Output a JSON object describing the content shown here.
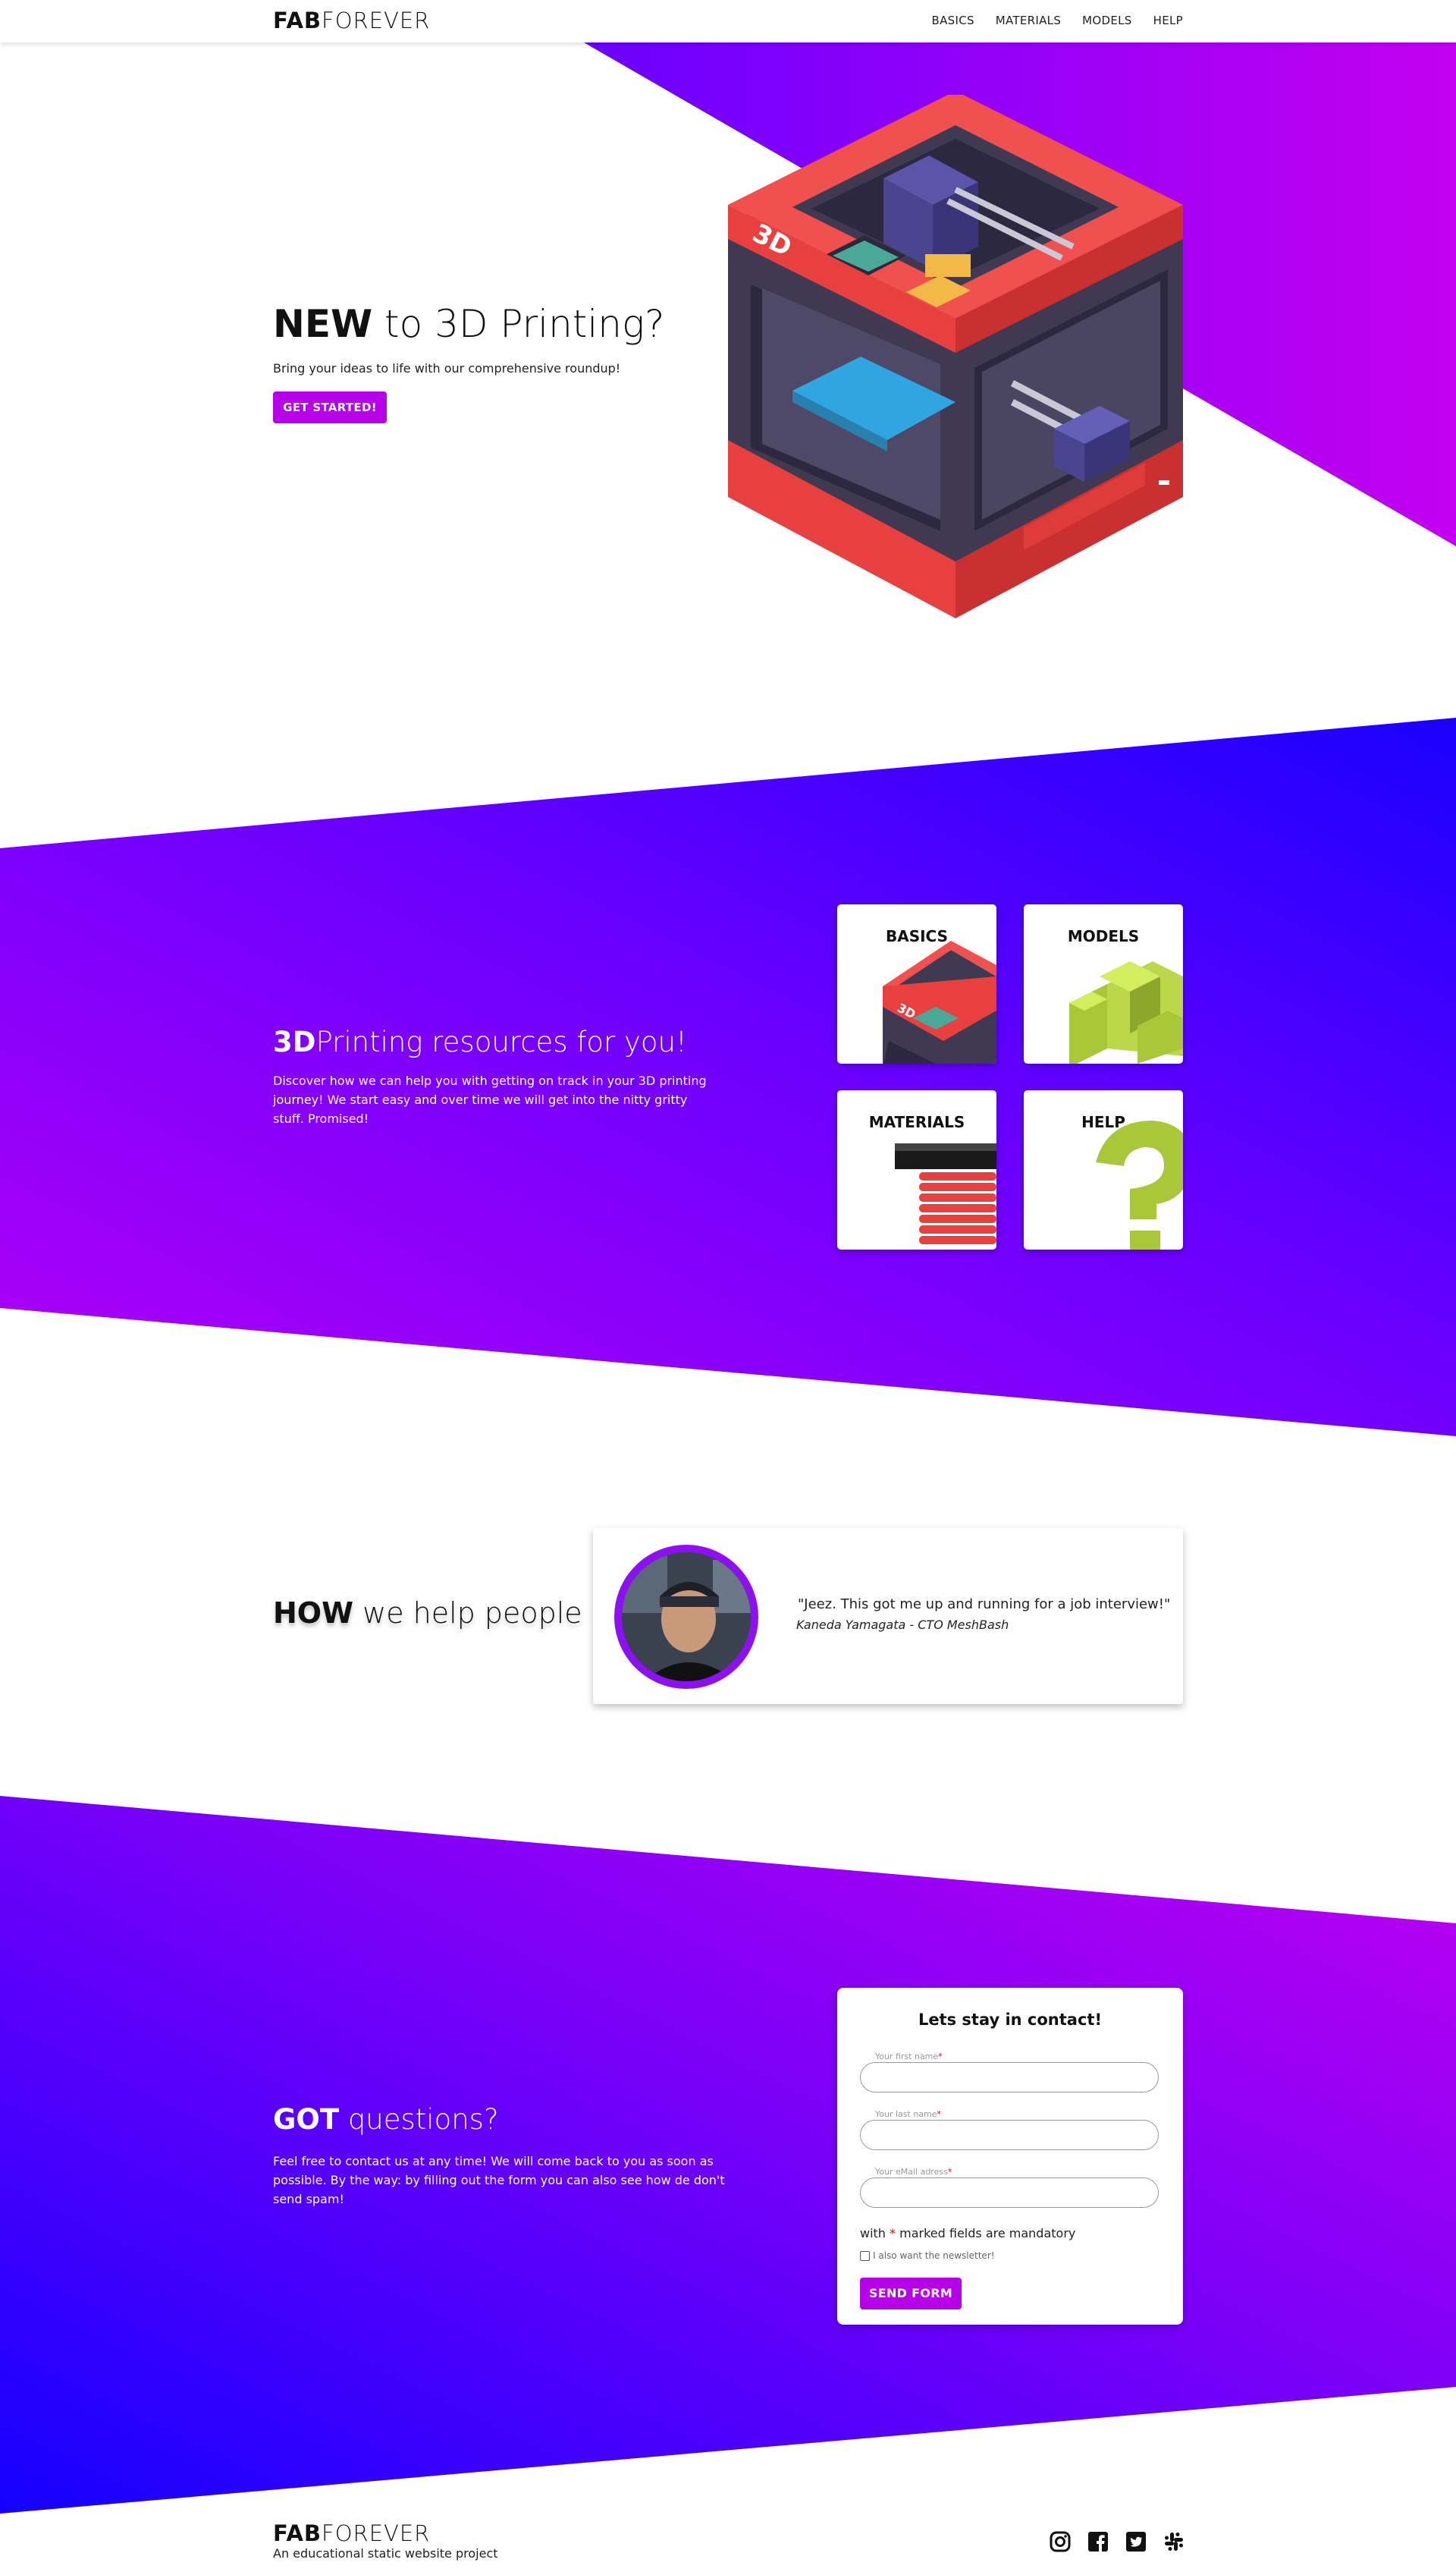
{
  "header": {
    "logo_bold": "FAB",
    "logo_light": "FOREVER",
    "nav": [
      "BASICS",
      "MATERIALS",
      "MODELS",
      "HELP"
    ]
  },
  "hero": {
    "title_bold": "NEW",
    "title_rest": " to 3D Printing?",
    "subtitle": "Bring your ideas to life with our comprehensive roundup!",
    "cta": "GET STARTED!",
    "printer_label": "3D"
  },
  "resources": {
    "title_bold": "3D",
    "title_rest": "Printing resources for you!",
    "text": "Discover how we can help you with getting on track in your 3D printing journey! We start easy and over time we will get into the nitty gritty stuff. Promised!",
    "tiles": [
      "BASICS",
      "MODELS",
      "MATERIALS",
      "HELP"
    ]
  },
  "how": {
    "title_bold": "HOW",
    "title_rest": " we help people",
    "quote": "\"Jeez. This got me up and running for a job interview!\"",
    "author": "Kaneda Yamagata - CTO MeshBash"
  },
  "contact": {
    "title_bold": "GOT",
    "title_rest": " questions?",
    "text": "Feel free to contact us at any time! We will come back to you as soon as possible. By the way: by filling out the form you can also see how de don't send spam!",
    "form_title": "Lets stay in contact!",
    "fields": [
      "Your first name",
      "Your last name",
      "Your eMail adress"
    ],
    "required_mark": "*",
    "mandatory_before": "with ",
    "mandatory_after": " marked fields are mandatory",
    "newsletter": "I also want the newsletter!",
    "submit": "SEND FORM"
  },
  "footer": {
    "logo_bold": "FAB",
    "logo_light": "FOREVER",
    "tagline": "An educational static website project",
    "socials": [
      "instagram-icon",
      "facebook-icon",
      "twitter-icon",
      "slack-icon"
    ]
  },
  "colors": {
    "purple": "#b600e8",
    "blue": "#1400ff",
    "printer_red": "#f0504e",
    "printer_dark": "#3f3a52",
    "accent_green": "#a8c83a"
  }
}
